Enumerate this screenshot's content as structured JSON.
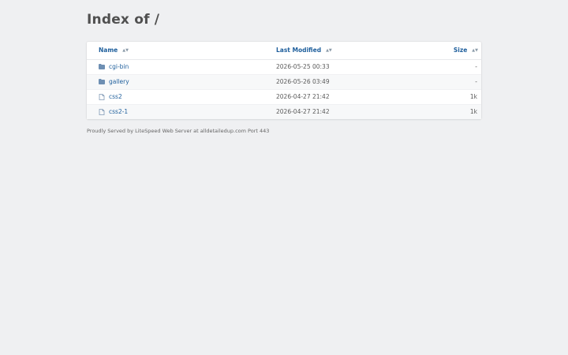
{
  "page": {
    "title": "Index of /"
  },
  "table": {
    "headers": {
      "name": "Name",
      "last_modified": "Last Modified",
      "size": "Size"
    },
    "rows": [
      {
        "icon": "folder-icon",
        "name": "cgi-bin",
        "modified": "2026-05-25 00:33",
        "size": "-"
      },
      {
        "icon": "folder-icon",
        "name": "gallery",
        "modified": "2026-05-26 03:49",
        "size": "-"
      },
      {
        "icon": "file-icon",
        "name": "css2",
        "modified": "2026-04-27 21:42",
        "size": "1k"
      },
      {
        "icon": "file-icon",
        "name": "css2-1",
        "modified": "2026-04-27 21:42",
        "size": "1k"
      }
    ]
  },
  "footer": {
    "text": "Proudly Served by LiteSpeed Web Server at alldetailedup.com Port 443"
  },
  "colors": {
    "background": "#eff0f2",
    "link": "#1f5f9c",
    "folder_icon": "#6e8fb3",
    "file_icon": "#7f98b5"
  }
}
